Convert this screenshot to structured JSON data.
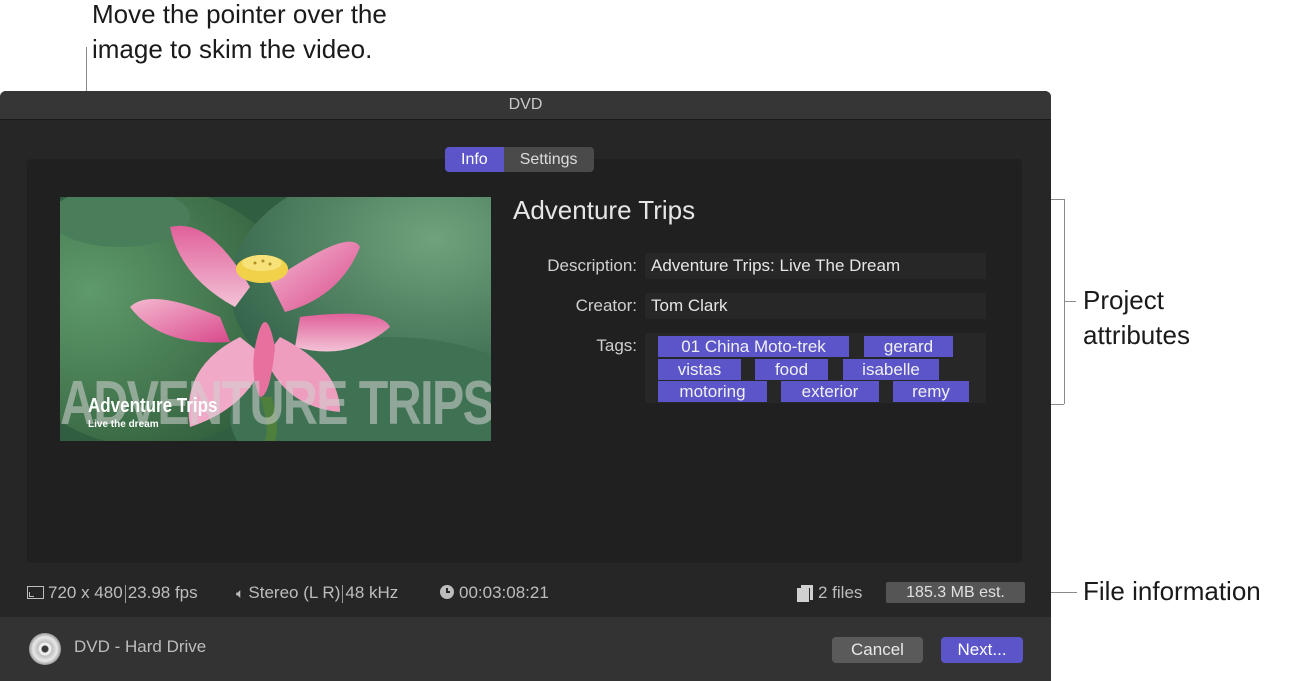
{
  "callouts": {
    "skim_line1": "Move the pointer over the",
    "skim_line2": "image to skim the video.",
    "attributes_line1": "Project",
    "attributes_line2": "attributes",
    "file_info": "File information"
  },
  "window": {
    "title": "DVD"
  },
  "tabs": [
    {
      "label": "Info",
      "active": true
    },
    {
      "label": "Settings",
      "active": false
    }
  ],
  "thumbnail": {
    "overlay_big": "ADVENTURE TRIPS",
    "overlay_title": "Adventure Trips",
    "overlay_subtitle": "Live the dream"
  },
  "project": {
    "title": "Adventure Trips",
    "description_label": "Description:",
    "description": "Adventure Trips: Live The Dream",
    "creator_label": "Creator:",
    "creator": "Tom Clark",
    "tags_label": "Tags:",
    "tags": [
      "01 China Moto-trek",
      "gerard",
      "vistas",
      "food",
      "isabelle",
      "motoring",
      "exterior",
      "remy"
    ]
  },
  "file_info": {
    "resolution": "720 x 480",
    "fps": "23.98 fps",
    "audio": "Stereo (L R)",
    "sample_rate": "48 kHz",
    "duration": "00:03:08:21",
    "files": "2 files",
    "size": "185.3 MB est."
  },
  "footer": {
    "destination": "DVD - Hard Drive",
    "cancel_label": "Cancel",
    "next_label": "Next..."
  },
  "colors": {
    "accent": "#5b55c9",
    "dialog_bg": "#262626"
  },
  "icons": [
    "frame-size-icon",
    "speaker-icon",
    "clock-icon",
    "files-icon",
    "dvd-disc-icon"
  ]
}
